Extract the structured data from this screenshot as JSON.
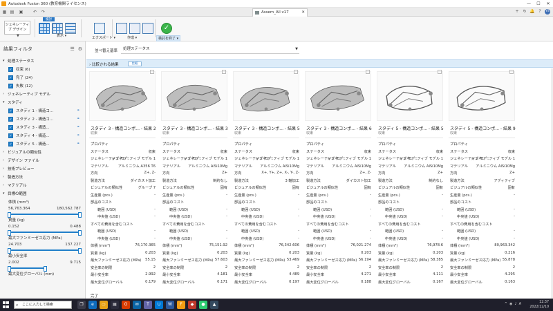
{
  "window": {
    "title": "Autodesk Fusion 360 (教育機関ライセンス)",
    "controls": [
      "—",
      "☐",
      "✕"
    ]
  },
  "docbar": {
    "tab_title": "Assem_All v17",
    "tab_close": "✕",
    "left_icons": [
      "grid-icon",
      "folder-icon",
      "save-icon",
      "undo-icon",
      "redo-icon"
    ],
    "right_icons": [
      "+",
      "↻",
      "🔔",
      "?",
      "YS"
    ]
  },
  "ribbon": {
    "workspace": "ジェネレーティブ デザイン",
    "workspace_chevron": "▼",
    "compare_tag": "検討",
    "groups": {
      "view": "表示 ▾",
      "export": "エクスポート ▾",
      "create": "作成 ▾",
      "finish": "検討を終了 ▾"
    }
  },
  "filters": {
    "title": "結果フィルタ",
    "sections": [
      {
        "label": "処理ステータス",
        "expanded": true
      },
      {
        "label": "ジェネレーティブ モデル",
        "expanded": false
      },
      {
        "label": "スタディ",
        "expanded": true
      },
      {
        "label": "ビジュアルの類似性",
        "expanded": false
      },
      {
        "label": "デザイン ファイル",
        "expanded": false
      },
      {
        "label": "技術プレビュー",
        "expanded": false
      },
      {
        "label": "製造方法",
        "expanded": false
      },
      {
        "label": "マテリアル",
        "expanded": false
      },
      {
        "label": "目標の範囲",
        "expanded": true
      }
    ],
    "status_items": [
      "収束 (6)",
      "完了 (24)",
      "失敗 (12)"
    ],
    "study_items": [
      "スタディ 1 - 構造コ...",
      "スタディ 2 - 構造コ...",
      "スタディ 3 - 構造...",
      "スタディ 4 - 構造...",
      "スタディ 5 - 構造..."
    ],
    "ranges": [
      {
        "label": "体積 (mm³)",
        "min": "56,763.364",
        "max": "180,562.787"
      },
      {
        "label": "質量 (kg)",
        "min": "0.152",
        "max": "0.488"
      },
      {
        "label": "最大ファンミーゼス応力 (MPa)",
        "min": "24.703",
        "max": "137.227"
      },
      {
        "label": "最小安全率",
        "min": "2.002",
        "max": "9.715"
      },
      {
        "label": "最大変位グローバル (mm)",
        "min": "",
        "max": ""
      }
    ]
  },
  "sort": {
    "label": "並べ替え基準",
    "value": "処理ステータス",
    "chevron": "▼"
  },
  "compare": {
    "title": "› 比較される結果",
    "button": "比較"
  },
  "row_labels": {
    "props": "プロパティ",
    "status": "ステータス",
    "gen_model": "ジェネレーティブ モデ...",
    "material": "マテリアル",
    "direction": "方向",
    "method": "製造方法",
    "visual": "ビジュアルの類似性",
    "production": "生産量 (pcs.)",
    "part_cost": "部品のコスト",
    "range_usd": "範囲 (USD)",
    "median_usd": "中央値 (USD)",
    "all_cost": "すべての費用を含むコスト",
    "volume": "体積 (mm³)",
    "mass": "質量 (kg)",
    "stress": "最大ファンミーゼス応力 (MPa)",
    "safety_limit": "安全率の制限",
    "min_safety": "最小安全率",
    "max_disp": "最大変位グローバル"
  },
  "results": [
    {
      "title": "スタディ 3 - 構造コンポ... - 結果 2",
      "sub": "収束",
      "status": "収束",
      "gen_model": "ジェネレーティブ モデル 1",
      "material": "アルミニウム A356 T6",
      "direction": "Z+, Z-",
      "method": "ダイカスト加工",
      "visual": "グループ 7",
      "production": "-",
      "range": "-",
      "median": "-",
      "range2": "-",
      "median2": "-",
      "volume": "76,170.365",
      "mass": "0.203",
      "stress": "55.15",
      "safety_limit": "2",
      "min_safety": "2.992",
      "max_disp": "0.179"
    },
    {
      "title": "スタディ 3 - 構造コンポ... - 結果 3",
      "sub": "収束",
      "status": "収束",
      "gen_model": "ジェネレーティブ モデル 1",
      "material": "アルミニウム AlSi10Mg",
      "direction": "Z+",
      "method": "制約なし",
      "visual": "固有",
      "production": "-",
      "range": "-",
      "median": "-",
      "range2": "-",
      "median2": "-",
      "volume": "75,151.92",
      "mass": "0.203",
      "stress": "57.603",
      "safety_limit": "2",
      "min_safety": "4.181",
      "max_disp": "0.171"
    },
    {
      "title": "スタディ 3 - 構造コンポ... - 結果 5",
      "sub": "収束",
      "status": "収束",
      "gen_model": "ジェネレーティブ モデル 1",
      "material": "アルミニウム AlSi10Mg",
      "direction": "X+, Y+, Z+, X-, Y-, Z-",
      "method": "3 軸加工",
      "visual": "固有",
      "production": "-",
      "range": "-",
      "median": "-",
      "range2": "-",
      "median2": "-",
      "volume": "76,342.606",
      "mass": "0.203",
      "stress": "53.469",
      "safety_limit": "2",
      "min_safety": "4.489",
      "max_disp": "0.197"
    },
    {
      "title": "スタディ 3 - 構造コンポ... - 結果 6",
      "sub": "収束",
      "status": "収束",
      "gen_model": "ジェネレーティブ モデル 1",
      "material": "アルミニウム AlSi10Mg",
      "direction": "Z+, Z-",
      "method": "ダイカスト加工",
      "visual": "固有",
      "production": "-",
      "range": "-",
      "median": "-",
      "range2": "-",
      "median2": "-",
      "volume": "76,021.274",
      "mass": "0.203",
      "stress": "56.194",
      "safety_limit": "2",
      "min_safety": "4.271",
      "max_disp": "0.188"
    },
    {
      "title": "スタディ 5 - 構造コンポ... - 結果 5",
      "sub": "収束",
      "status": "収束",
      "gen_model": "ジェネレーティブ モデル 1",
      "material": "アルミニウム AlSi10Mg",
      "direction": "Z+",
      "method": "制約なし",
      "visual": "固有",
      "production": "-",
      "range": "-",
      "median": "-",
      "range2": "-",
      "median2": "-",
      "volume": "76,978.6",
      "mass": "0.203",
      "stress": "58.385",
      "safety_limit": "2",
      "min_safety": "4.111",
      "max_disp": "0.167"
    },
    {
      "title": "スタディ 5 - 構造コンポ... - 結果 9",
      "sub": "収束",
      "status": "収束",
      "gen_model": "ジェネレーティブ モデル 1",
      "material": "アルミニウム AlSi10Mg",
      "direction": "Z+",
      "method": "アディティブ",
      "visual": "固有",
      "production": "-",
      "range": "-",
      "median": "-",
      "range2": "-",
      "median2": "-",
      "volume": "80,963.342",
      "mass": "0.216",
      "stress": "55.878",
      "safety_limit": "2",
      "min_safety": "4.295",
      "max_disp": "0.163"
    }
  ],
  "footer": {
    "done_label": "完了"
  },
  "taskbar": {
    "search_placeholder": "ここに入力して検索",
    "time": "12:37",
    "date": "2022/12/10",
    "tray_lang": "A"
  }
}
